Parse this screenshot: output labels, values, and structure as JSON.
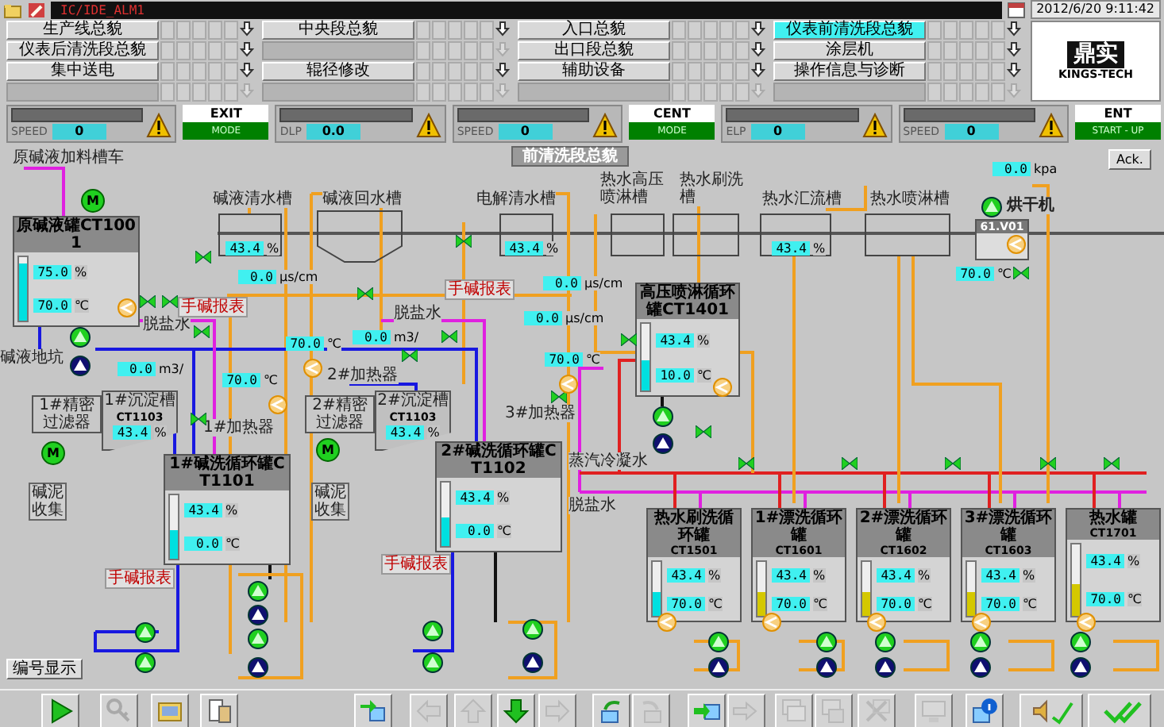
{
  "status_bar": {
    "alarm_text": "IC/IDE_ALM1",
    "datetime": "2012/6/20 9:11:42"
  },
  "nav_buttons": [
    {
      "label": "生产线总貌",
      "selected": false,
      "disabled": false
    },
    {
      "label": "中央段总貌",
      "selected": false,
      "disabled": false
    },
    {
      "label": "入口总貌",
      "selected": false,
      "disabled": false
    },
    {
      "label": "仪表前清洗段总貌",
      "selected": true,
      "disabled": false
    },
    {
      "label": "仪表后清洗段总貌",
      "selected": false,
      "disabled": false
    },
    {
      "selected": false,
      "disabled": true
    },
    {
      "label": "出口段总貌",
      "selected": false,
      "disabled": false
    },
    {
      "label": "涂层机",
      "selected": false,
      "disabled": false
    },
    {
      "label": "集中送电",
      "selected": false,
      "disabled": false
    },
    {
      "label": "辊径修改",
      "selected": false,
      "disabled": false
    },
    {
      "label": "辅助设备",
      "selected": false,
      "disabled": false
    },
    {
      "label": "操作信息与诊断",
      "selected": false,
      "disabled": false
    },
    {
      "selected": false,
      "disabled": true
    },
    {
      "selected": false,
      "disabled": true
    },
    {
      "selected": false,
      "disabled": true
    },
    {
      "selected": false,
      "disabled": true
    }
  ],
  "logo": {
    "name": "鼎实",
    "subtitle": "KINGS-TECH"
  },
  "gauges": [
    {
      "label": "SPEED",
      "value": "0",
      "mode": {
        "title": "EXIT",
        "state": "MODE"
      }
    },
    {
      "label": "DLP",
      "value": "0.0"
    },
    {
      "label": "SPEED",
      "value": "0",
      "mode": {
        "title": "CENT",
        "state": "MODE"
      }
    },
    {
      "label": "ELP",
      "value": "0"
    },
    {
      "label": "SPEED",
      "value": "0",
      "mode": {
        "title": "ENT",
        "state": "START - UP"
      }
    }
  ],
  "diagram": {
    "title": "前清洗段总貌",
    "ack": "Ack.",
    "labels": [
      "原碱液加料槽车",
      "碱液清水槽",
      "碱液回水槽",
      "电解清水槽",
      "热水高压喷淋槽",
      "热水刷洗槽",
      "热水汇流槽",
      "热水喷淋槽",
      "脱盐水",
      "脱盐水",
      "碱液地坑",
      "1#加热器",
      "2#加热器",
      "3#加热器",
      "蒸汽冷凝水",
      "脱盐水"
    ],
    "tanks": [
      {
        "title": "原碱液罐CT1001",
        "level": 0.9,
        "color": "#00e0e0",
        "readings": [
          {
            "value": "75.0",
            "unit": "%"
          },
          {
            "value": "70.0",
            "unit": "℃"
          }
        ]
      },
      {
        "title": "高压喷淋循环罐CT1401",
        "level": 0.45,
        "color": "#00e0e0",
        "readings": [
          {
            "value": "43.4",
            "unit": "%"
          },
          {
            "value": "10.0",
            "unit": "℃"
          }
        ]
      },
      {
        "title": "1#碱洗循环罐CT1101",
        "level": 0.45,
        "color": "#00e0e0",
        "readings": [
          {
            "value": "43.4",
            "unit": "%"
          },
          {
            "value": "0.0",
            "unit": "℃"
          }
        ]
      },
      {
        "title": "2#碱洗循环罐CT1102",
        "level": 0.45,
        "color": "#00e0e0",
        "readings": [
          {
            "value": "43.4",
            "unit": "%"
          },
          {
            "value": "0.0",
            "unit": "℃"
          }
        ]
      },
      {
        "title": "热水刷洗循环罐",
        "tag": "CT1501",
        "level": 0.45,
        "color": "#00e0e0",
        "readings": [
          {
            "value": "43.4",
            "unit": "%"
          },
          {
            "value": "70.0",
            "unit": "℃"
          }
        ]
      },
      {
        "title": "1#漂洗循环罐",
        "tag": "CT1601",
        "level": 0.45,
        "color": "#d4c800",
        "readings": [
          {
            "value": "43.4",
            "unit": "%"
          },
          {
            "value": "70.0",
            "unit": "℃"
          }
        ]
      },
      {
        "title": "2#漂洗循环罐",
        "tag": "CT1602",
        "level": 0.45,
        "color": "#d4c800",
        "readings": [
          {
            "value": "43.4",
            "unit": "%"
          },
          {
            "value": "70.0",
            "unit": "℃"
          }
        ]
      },
      {
        "title": "3#漂洗循环罐",
        "tag": "CT1603",
        "level": 0.45,
        "color": "#d4c800",
        "readings": [
          {
            "value": "43.4",
            "unit": "%"
          },
          {
            "value": "70.0",
            "unit": "℃"
          }
        ]
      },
      {
        "title": "热水罐",
        "tag": "CT1701",
        "level": 0.45,
        "color": "#d4c800",
        "readings": [
          {
            "value": "43.4",
            "unit": "%"
          },
          {
            "value": "70.0",
            "unit": "℃"
          }
        ]
      }
    ],
    "settlers": [
      {
        "title": "1#沉淀槽",
        "tag": "CT1103",
        "value": "43.4",
        "unit": "%"
      },
      {
        "title": "2#沉淀槽",
        "tag": "CT1103",
        "value": "43.4",
        "unit": "%"
      }
    ],
    "filters": [
      "1#精密过滤器",
      "2#精密过滤器"
    ],
    "sludge_boxes": [
      "碱泥收集",
      "碱泥收集"
    ],
    "report_tags": [
      "手碱报表",
      "手碱报表",
      "手碱报表",
      "手碱报表"
    ],
    "dryer": {
      "label": "烘干机",
      "tag": "61.V01"
    },
    "readouts": [
      {
        "value": "0.0",
        "unit": "kpa"
      },
      {
        "value": "43.4",
        "unit": "%"
      },
      {
        "value": "43.4",
        "unit": "%"
      },
      {
        "value": "43.4",
        "unit": "%"
      },
      {
        "value": "70.0",
        "unit": "℃"
      },
      {
        "value": "0.0",
        "unit": "μs/cm"
      },
      {
        "value": "0.0",
        "unit": "μs/cm"
      },
      {
        "value": "0.0",
        "unit": "μs/cm"
      },
      {
        "value": "0.0",
        "unit": "m3/"
      },
      {
        "value": "70.0",
        "unit": "℃"
      },
      {
        "value": "70.0",
        "unit": "℃"
      },
      {
        "value": "0.0",
        "unit": "m3/"
      },
      {
        "value": "70.0",
        "unit": "℃"
      }
    ],
    "motors": [
      "M",
      "M",
      "M"
    ],
    "pumps": [
      {
        "running": true
      },
      {
        "running": false
      },
      {
        "running": true
      },
      {
        "running": false
      },
      {
        "running": true
      },
      {
        "running": false
      },
      {
        "running": true
      },
      {
        "running": true
      },
      {
        "running": true
      },
      {
        "running": true
      },
      {
        "running": true
      },
      {
        "running": false
      },
      {
        "running": true
      },
      {
        "running": false
      },
      {
        "running": true
      },
      {
        "running": false
      },
      {
        "running": true
      },
      {
        "running": false
      },
      {
        "running": true
      },
      {
        "running": false
      },
      {
        "running": true
      },
      {
        "running": false
      },
      {
        "running": true
      },
      {
        "running": false
      },
      {
        "running": true
      }
    ],
    "number_button": "编号显示"
  },
  "toolbar": [
    {
      "disabled": false
    },
    {
      "disabled": true
    },
    {
      "disabled": false
    },
    {
      "disabled": false
    },
    {
      "disabled": false
    },
    {
      "disabled": true
    },
    {
      "disabled": true
    },
    {
      "disabled": false
    },
    {
      "disabled": true
    },
    {
      "disabled": false
    },
    {
      "disabled": true
    },
    {
      "disabled": false
    },
    {
      "disabled": true
    },
    {
      "disabled": true
    },
    {
      "disabled": true
    },
    {
      "disabled": true
    },
    {
      "disabled": true
    },
    {
      "disabled": false
    },
    {
      "disabled": false
    },
    {
      "disabled": false
    }
  ]
}
